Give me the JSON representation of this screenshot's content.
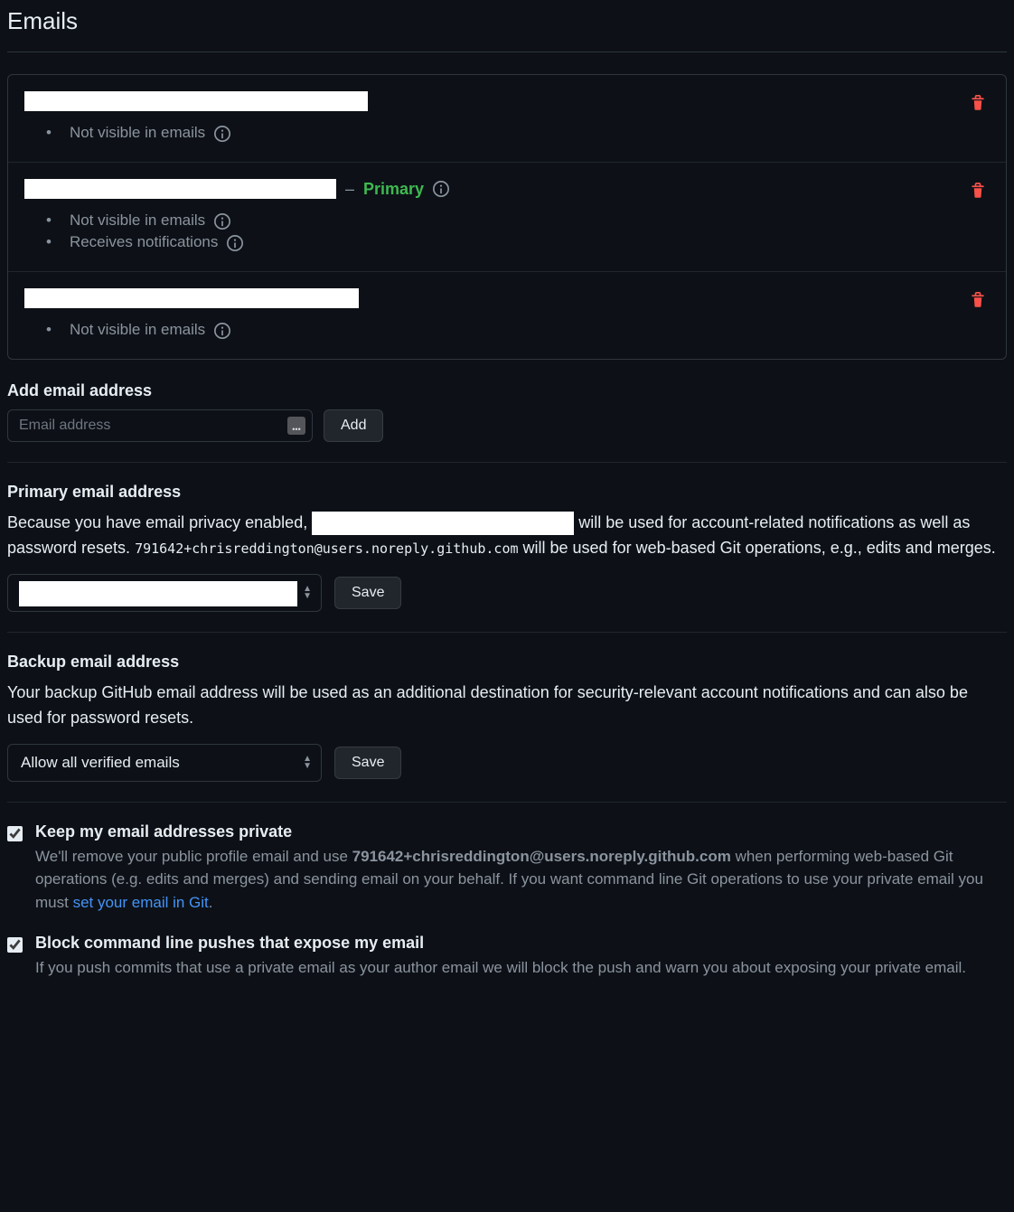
{
  "page_title": "Emails",
  "emails": [
    {
      "notes": [
        "Not visible in emails"
      ],
      "primary": false
    },
    {
      "notes": [
        "Not visible in emails",
        "Receives notifications"
      ],
      "primary": true,
      "primary_label": "Primary"
    },
    {
      "notes": [
        "Not visible in emails"
      ],
      "primary": false
    }
  ],
  "add_section": {
    "heading": "Add email address",
    "placeholder": "Email address",
    "button": "Add"
  },
  "primary_section": {
    "heading": "Primary email address",
    "text_before": "Because you have email privacy enabled, ",
    "text_mid": " will be used for account-related notifications as well as password resets. ",
    "noreply": "791642+chrisreddington@users.noreply.github.com",
    "text_after": " will be used for web-based Git operations, e.g., edits and merges.",
    "save": "Save"
  },
  "backup_section": {
    "heading": "Backup email address",
    "description": "Your backup GitHub email address will be used as an additional destination for security-relevant account notifications and can also be used for password resets.",
    "selected": "Allow all verified emails",
    "save": "Save"
  },
  "keep_private": {
    "title": "Keep my email addresses private",
    "desc_before": "We'll remove your public profile email and use ",
    "noreply": "791642+chrisreddington@users.noreply.github.com",
    "desc_mid": " when performing web-based Git operations (e.g. edits and merges) and sending email on your behalf. If you want command line Git operations to use your private email you must ",
    "link": "set your email in Git",
    "desc_after": "."
  },
  "block_push": {
    "title": "Block command line pushes that expose my email",
    "desc": "If you push commits that use a private email as your author email we will block the push and warn you about exposing your private email."
  }
}
